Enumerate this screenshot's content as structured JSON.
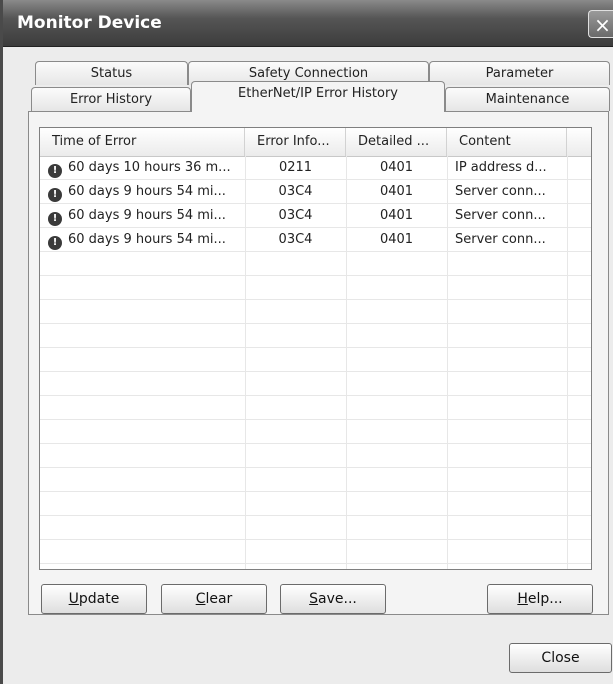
{
  "window": {
    "title": "Monitor Device",
    "close_glyph": "×"
  },
  "tabs": {
    "row1": [
      "Status",
      "Safety Connection",
      "Parameter"
    ],
    "row2": [
      "Error History",
      "EtherNet/IP Error History",
      "Maintenance"
    ],
    "active": "EtherNet/IP Error History"
  },
  "table": {
    "columns": [
      "Time of Error",
      "Error Info...",
      "Detailed ...",
      "Content"
    ],
    "rows": [
      {
        "time": "60 days 10 hours 36 m...",
        "info": "0211",
        "detail": "0401",
        "content": "IP address d..."
      },
      {
        "time": "60 days 9 hours 54 mi...",
        "info": "03C4",
        "detail": "0401",
        "content": "Server conn..."
      },
      {
        "time": "60 days 9 hours 54 mi...",
        "info": "03C4",
        "detail": "0401",
        "content": "Server conn..."
      },
      {
        "time": "60 days 9 hours 54 mi...",
        "info": "03C4",
        "detail": "0401",
        "content": "Server conn..."
      }
    ],
    "row_icon": "error-icon"
  },
  "buttons": {
    "update": {
      "hotkey": "U",
      "rest": "pdate"
    },
    "clear": {
      "hotkey": "C",
      "rest": "lear"
    },
    "save": {
      "hotkey": "S",
      "rest": "ave..."
    },
    "help": {
      "hotkey": "H",
      "rest": "elp..."
    },
    "close": "Close"
  }
}
